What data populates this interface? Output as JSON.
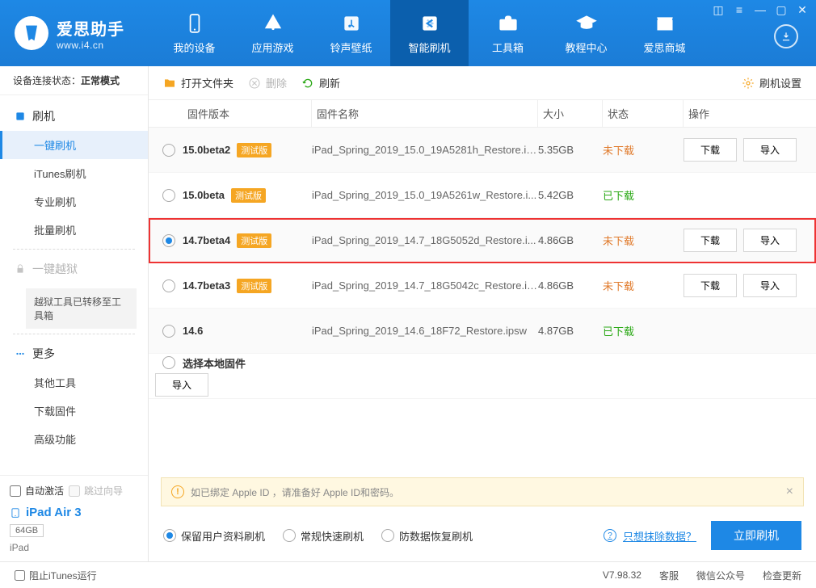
{
  "brand": {
    "name": "爱思助手",
    "url": "www.i4.cn"
  },
  "nav": {
    "items": [
      {
        "label": "我的设备"
      },
      {
        "label": "应用游戏"
      },
      {
        "label": "铃声壁纸"
      },
      {
        "label": "智能刷机"
      },
      {
        "label": "工具箱"
      },
      {
        "label": "教程中心"
      },
      {
        "label": "爱思商城"
      }
    ]
  },
  "sidebar": {
    "conn_label": "设备连接状态：",
    "conn_value": "正常模式",
    "group1": {
      "title": "刷机",
      "items": [
        "一键刷机",
        "iTunes刷机",
        "专业刷机",
        "批量刷机"
      ]
    },
    "group2": {
      "title": "一键越狱",
      "notice": "越狱工具已转移至工具箱"
    },
    "group3": {
      "title": "更多",
      "items": [
        "其他工具",
        "下载固件",
        "高级功能"
      ]
    },
    "auto_activate": "自动激活",
    "skip_guide": "跳过向导",
    "device_name": "iPad Air 3",
    "storage": "64GB",
    "device_model": "iPad"
  },
  "toolbar": {
    "open_folder": "打开文件夹",
    "delete": "删除",
    "refresh": "刷新",
    "settings": "刷机设置"
  },
  "table": {
    "head": {
      "version": "固件版本",
      "name": "固件名称",
      "size": "大小",
      "status": "状态",
      "ops": "操作"
    },
    "beta_tag": "测试版",
    "download": "下载",
    "import_btn": "导入",
    "local_label": "选择本地固件",
    "rows": [
      {
        "version": "15.0beta2",
        "beta": true,
        "file": "iPad_Spring_2019_15.0_19A5281h_Restore.ip...",
        "size": "5.35GB",
        "status": "未下载",
        "status_cls": "nd",
        "dl": true,
        "imp": true,
        "sel": false
      },
      {
        "version": "15.0beta",
        "beta": true,
        "file": "iPad_Spring_2019_15.0_19A5261w_Restore.i...",
        "size": "5.42GB",
        "status": "已下载",
        "status_cls": "dl",
        "dl": false,
        "imp": false,
        "sel": false
      },
      {
        "version": "14.7beta4",
        "beta": true,
        "file": "iPad_Spring_2019_14.7_18G5052d_Restore.i...",
        "size": "4.86GB",
        "status": "未下载",
        "status_cls": "nd",
        "dl": true,
        "imp": true,
        "sel": true
      },
      {
        "version": "14.7beta3",
        "beta": true,
        "file": "iPad_Spring_2019_14.7_18G5042c_Restore.ip...",
        "size": "4.86GB",
        "status": "未下载",
        "status_cls": "nd",
        "dl": true,
        "imp": true,
        "sel": false
      },
      {
        "version": "14.6",
        "beta": false,
        "file": "iPad_Spring_2019_14.6_18F72_Restore.ipsw",
        "size": "4.87GB",
        "status": "已下载",
        "status_cls": "dl",
        "dl": false,
        "imp": false,
        "sel": false
      }
    ]
  },
  "warn": "如已绑定 Apple ID ，请准备好 Apple ID和密码。",
  "actions": {
    "keep_data": "保留用户资料刷机",
    "normal": "常规快速刷机",
    "anti_deg": "防数据恢复刷机",
    "erase_link": "只想抹除数据？",
    "flash_btn": "立即刷机"
  },
  "status": {
    "block_itunes": "阻止iTunes运行",
    "version_label": "V7.98.32",
    "service": "客服",
    "wechat": "微信公众号",
    "update": "检查更新"
  }
}
